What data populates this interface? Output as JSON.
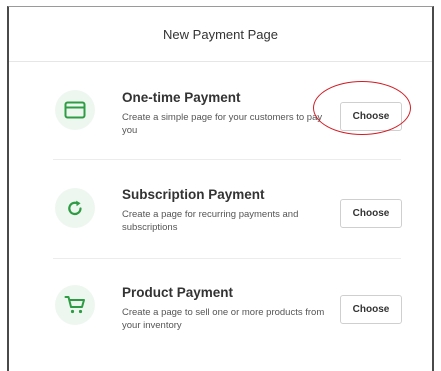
{
  "modal": {
    "title": "New Payment Page"
  },
  "options": [
    {
      "title": "One-time Payment",
      "description": "Create a simple page for your customers to pay you",
      "button": "Choose",
      "icon": "credit-card-icon"
    },
    {
      "title": "Subscription Payment",
      "description": "Create a page for recurring payments and subscriptions",
      "button": "Choose",
      "icon": "refresh-icon"
    },
    {
      "title": "Product Payment",
      "description": "Create a page to sell one or more products from your inventory",
      "button": "Choose",
      "icon": "shopping-cart-icon"
    }
  ],
  "colors": {
    "icon_green": "#2e9c44",
    "icon_bg": "#eef7ef",
    "annotation_red": "#d21c24"
  }
}
